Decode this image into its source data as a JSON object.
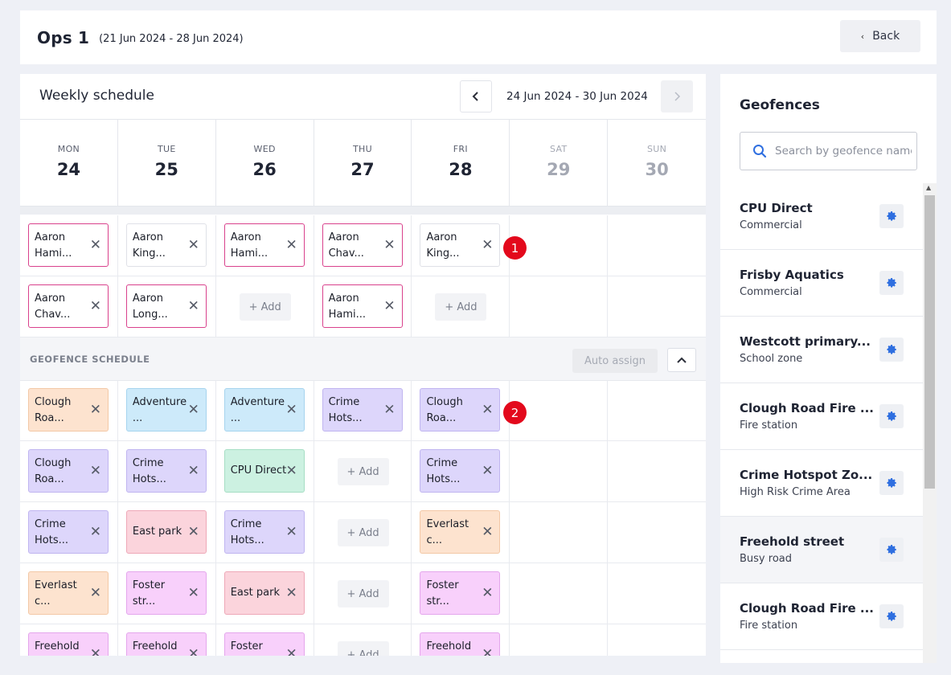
{
  "header": {
    "title": "Ops 1",
    "date_range": "(21 Jun 2024 - 28 Jun 2024)",
    "back_label": "Back"
  },
  "schedule": {
    "title": "Weekly schedule",
    "week_range": "24 Jun 2024 - 30 Jun 2024",
    "days": [
      {
        "name": "MON",
        "date": "24"
      },
      {
        "name": "TUE",
        "date": "25"
      },
      {
        "name": "WED",
        "date": "26"
      },
      {
        "name": "THU",
        "date": "27"
      },
      {
        "name": "FRI",
        "date": "28"
      },
      {
        "name": "SAT",
        "date": "29"
      },
      {
        "name": "SUN",
        "date": "30"
      }
    ],
    "staff_rows": [
      [
        "Aaron\nHami...",
        "Aaron\nKing...",
        "Aaron\nHami...",
        "Aaron\nChav...",
        "Aaron\nKing..."
      ],
      [
        "Aaron\nChav...",
        "Aaron\nLong...",
        "+ Add",
        "Aaron\nHami...",
        "+ Add"
      ]
    ],
    "badges": [
      "1",
      "2"
    ],
    "geofence_header": "GEOFENCE SCHEDULE",
    "auto_assign_label": "Auto assign",
    "add_label": "+ Add",
    "geo_rows": [
      [
        "Clough\nRoa...",
        "Adventure\n...",
        "Adventure\n...",
        "Crime\nHots...",
        "Clough\nRoa..."
      ],
      [
        "Clough\nRoa...",
        "Crime\nHots...",
        "CPU Direct",
        "+ Add",
        "Crime\nHots..."
      ],
      [
        "Crime\nHots...",
        "East park",
        "Crime\nHots...",
        "+ Add",
        "Everlast\nc..."
      ],
      [
        "Everlast\nc...",
        "Foster\nstr...",
        "East park",
        "+ Add",
        "Foster\nstr..."
      ],
      [
        "Freehold\n",
        "Freehold\n",
        "Foster\n",
        "+ Add",
        "Freehold\n"
      ]
    ]
  },
  "geofences": {
    "title": "Geofences",
    "search_placeholder": "Search by geofence name",
    "items": [
      {
        "name": "CPU Direct",
        "type": "Commercial"
      },
      {
        "name": "Frisby Aquatics",
        "type": "Commercial"
      },
      {
        "name": "Westcott primary...",
        "type": "School zone"
      },
      {
        "name": "Clough Road Fire ...",
        "type": "Fire station"
      },
      {
        "name": "Crime Hotspot Zo...",
        "type": "High Risk Crime Area"
      },
      {
        "name": "Freehold street",
        "type": "Busy road"
      },
      {
        "name": "Clough Road Fire ...",
        "type": "Fire station"
      }
    ]
  },
  "colors": {
    "accent_blue": "#2f6fe0",
    "badge_red": "#e3091c",
    "staff_chip_border": "#d9418c"
  }
}
